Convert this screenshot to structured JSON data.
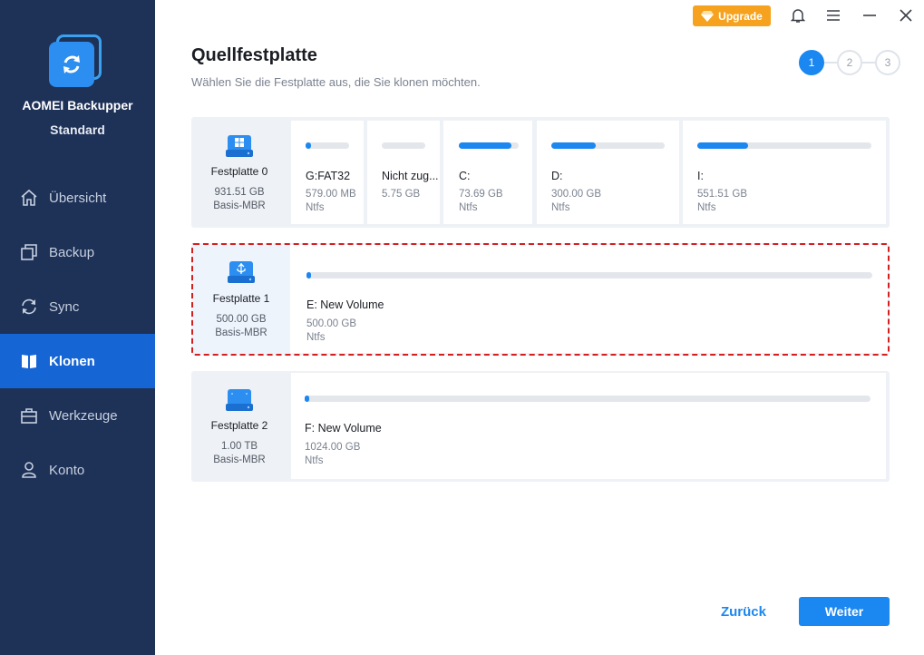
{
  "app": {
    "name": "AOMEI Backupper",
    "edition": "Standard"
  },
  "nav": [
    {
      "label": "Übersicht",
      "icon": "home-icon",
      "active": false
    },
    {
      "label": "Backup",
      "icon": "backup-icon",
      "active": false
    },
    {
      "label": "Sync",
      "icon": "sync-icon",
      "active": false
    },
    {
      "label": "Klonen",
      "icon": "clone-icon",
      "active": true
    },
    {
      "label": "Werkzeuge",
      "icon": "toolbox-icon",
      "active": false
    },
    {
      "label": "Konto",
      "icon": "user-icon",
      "active": false
    }
  ],
  "topbar": {
    "upgrade_label": "Upgrade",
    "icons": [
      "bell-icon",
      "menu-icon",
      "minimize-icon",
      "close-icon"
    ]
  },
  "header": {
    "title": "Quellfestplatte",
    "subtitle": "Wählen Sie die Festplatte aus, die Sie klonen möchten."
  },
  "steps": [
    "1",
    "2",
    "3"
  ],
  "current_step": 1,
  "disks": [
    {
      "name": "Festplatte 0",
      "size": "931.51 GB",
      "type": "Basis-MBR",
      "icon": "windows-disk-icon",
      "selected": false,
      "partitions": [
        {
          "label": "G:FAT32",
          "size": "579.00 MB",
          "fs": "Ntfs",
          "used": 0.12
        },
        {
          "label": "Nicht zug...",
          "size": "5.75 GB",
          "fs": "",
          "used": 0.0
        },
        {
          "label": "C:",
          "size": "73.69 GB",
          "fs": "Ntfs",
          "used": 0.88
        },
        {
          "label": "D:",
          "size": "300.00 GB",
          "fs": "Ntfs",
          "used": 0.39
        },
        {
          "label": "I:",
          "size": "551.51 GB",
          "fs": "Ntfs",
          "used": 0.29
        }
      ]
    },
    {
      "name": "Festplatte 1",
      "size": "500.00 GB",
      "type": "Basis-MBR",
      "icon": "usb-disk-icon",
      "selected": true,
      "partitions": [
        {
          "label": "E: New Volume",
          "size": "500.00 GB",
          "fs": "Ntfs",
          "used": 0.005
        }
      ]
    },
    {
      "name": "Festplatte 2",
      "size": "1.00 TB",
      "type": "Basis-MBR",
      "icon": "disk-icon",
      "selected": false,
      "partitions": [
        {
          "label": "F: New Volume",
          "size": "1024.00 GB",
          "fs": "Ntfs",
          "used": 0.005
        }
      ]
    }
  ],
  "footer": {
    "back_label": "Zurück",
    "next_label": "Weiter"
  },
  "colors": {
    "sidebar": "#1e3157",
    "active_nav": "#1565d4",
    "accent": "#1b87f0",
    "upgrade": "#f6a21e",
    "selection_border": "#d51f1f"
  }
}
